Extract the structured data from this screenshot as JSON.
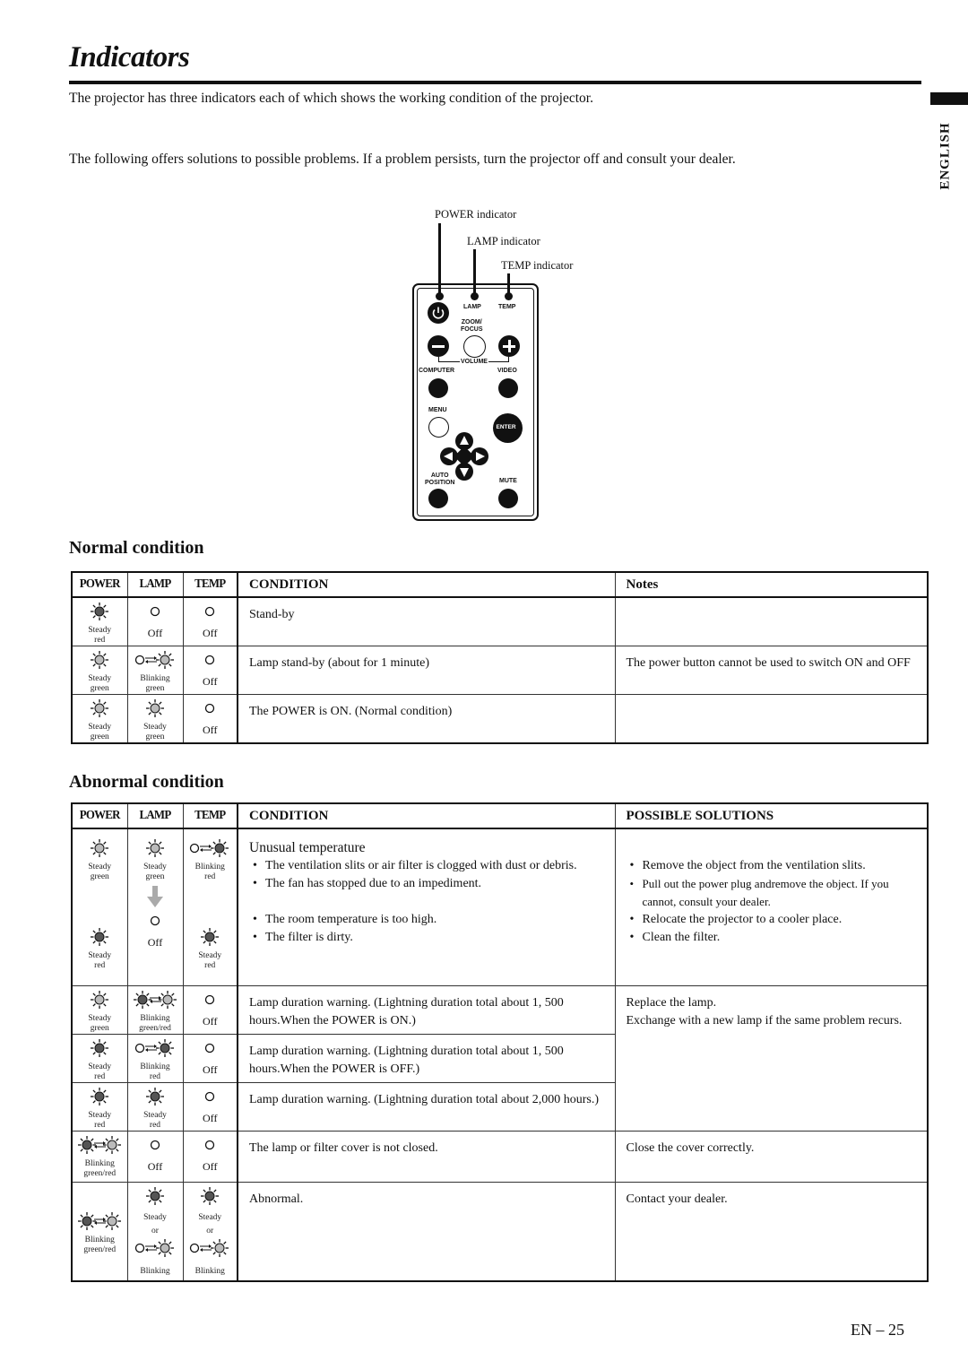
{
  "page": {
    "title": "Indicators",
    "intro_1": "The projector has three indicators each of which shows the working condition of the projector.",
    "intro_2": "The following offers solutions to possible problems. If a problem persists, turn the projector off and consult your dealer.",
    "language_tab": "ENGLISH",
    "page_number": "EN – 25"
  },
  "diagram": {
    "callouts": [
      "POWER indicator",
      "LAMP indicator",
      "TEMP indicator"
    ],
    "remote_labels": {
      "lamp": "LAMP",
      "temp": "TEMP",
      "zoom_focus": "ZOOM/\nFOCUS",
      "volume": "VOLUME",
      "computer": "COMPUTER",
      "video": "VIDEO",
      "menu": "MENU",
      "enter": "ENTER",
      "auto_position": "AUTO\nPOSITION",
      "mute": "MUTE"
    }
  },
  "normal": {
    "heading": "Normal condition",
    "headers": {
      "power": "POWER",
      "lamp": "LAMP",
      "temp": "TEMP",
      "condition": "CONDITION",
      "notes": "Notes"
    },
    "rows": [
      {
        "power": {
          "icon": "steady-red",
          "caption": "Steady\nred"
        },
        "lamp": {
          "icon": "off",
          "caption": "Off"
        },
        "temp": {
          "icon": "off",
          "caption": "Off"
        },
        "condition": "Stand-by",
        "notes": ""
      },
      {
        "power": {
          "icon": "steady-green",
          "caption": "Steady\ngreen"
        },
        "lamp": {
          "icon": "blinking-green",
          "caption": "Blinking\ngreen"
        },
        "temp": {
          "icon": "off",
          "caption": "Off"
        },
        "condition": "Lamp stand-by (about for 1 minute)",
        "notes": "The power button cannot be used to switch ON and OFF"
      },
      {
        "power": {
          "icon": "steady-green",
          "caption": "Steady\ngreen"
        },
        "lamp": {
          "icon": "steady-green",
          "caption": "Steady\ngreen"
        },
        "temp": {
          "icon": "off",
          "caption": "Off"
        },
        "condition": "The POWER is ON. (Normal condition)",
        "notes": ""
      }
    ]
  },
  "abnormal": {
    "heading": "Abnormal condition",
    "headers": {
      "power": "POWER",
      "lamp": "LAMP",
      "temp": "TEMP",
      "condition": "CONDITION",
      "solutions": "POSSIBLE SOLUTIONS"
    },
    "temperature": {
      "power_before": "Steady\ngreen",
      "lamp_before": "Steady\ngreen",
      "temp_before": "Blinking\nred",
      "power_after": "Steady\nred",
      "lamp_after": "Off",
      "temp_after": "Steady\nred",
      "condition_title": "Unusual temperature",
      "conditions": [
        "The ventilation slits or air filter is clogged with dust or debris.",
        "The fan has stopped due to an impediment.",
        "The room temperature is too high.",
        "The filter is dirty."
      ],
      "solutions": [
        "Remove the object from the ventilation slits.",
        "Pull out the power plug andremove the object. If you cannot, consult your dealer.",
        "Relocate the projector to a cooler place.",
        "Clean the filter."
      ]
    },
    "lamp_rows": [
      {
        "power": "Steady\ngreen",
        "lamp": "Blinking\ngreen/red",
        "temp": "Off",
        "condition": "Lamp duration warning. (Lightning duration total about 1, 500 hours.When the POWER is ON.)"
      },
      {
        "power": "Steady\nred",
        "lamp": "Blinking\nred",
        "temp": "Off",
        "condition": "Lamp duration warning. (Lightning duration total about 1, 500 hours.When the POWER is OFF.)"
      },
      {
        "power": "Steady\nred",
        "lamp": "Steady\nred",
        "temp": "Off",
        "condition": "Lamp duration warning. (Lightning duration total about 2,000 hours.)"
      }
    ],
    "lamp_solution": [
      "Replace the lamp.",
      "Exchange with a new lamp if the same problem recurs."
    ],
    "cover_row": {
      "power": "Blinking\ngreen/red",
      "lamp": "Off",
      "temp": "Off",
      "condition": "The lamp or filter cover is not closed.",
      "solution": "Close the cover correctly."
    },
    "abnormal_row": {
      "power": "Blinking\ngreen/red",
      "lamp_steady": "Steady",
      "lamp_or": "or",
      "lamp_blinking": "Blinking",
      "temp_steady": "Steady",
      "temp_or": "or",
      "temp_blinking": "Blinking",
      "condition": "Abnormal.",
      "solution": "Contact your dealer."
    }
  },
  "colors": {
    "ink": "#111111",
    "led_red": "#555555",
    "led_green": "#bbbbbb"
  }
}
